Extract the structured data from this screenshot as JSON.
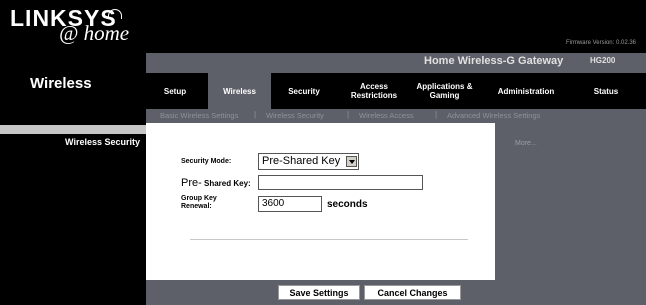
{
  "brand": {
    "name": "LINKSYS",
    "tagline": "@ home"
  },
  "firmware": "Firmware Version: 0.02.36",
  "section": {
    "title": "Wireless",
    "sub_section": "Wireless Security"
  },
  "product": {
    "name": "Home Wireless-G Gateway",
    "model": "HG200"
  },
  "tabs": [
    {
      "label": "Setup",
      "active": false
    },
    {
      "label": "Wireless",
      "active": true
    },
    {
      "label": "Security",
      "active": false
    },
    {
      "label": "Access Restrictions",
      "active": false
    },
    {
      "label": "Applications & Gaming",
      "active": false
    },
    {
      "label": "Administration",
      "active": false
    },
    {
      "label": "Status",
      "active": false
    }
  ],
  "subtabs": [
    "Basic Wireless Settings",
    "Wireless Security",
    "Wireless Access",
    "Advanced Wireless Settings"
  ],
  "form": {
    "security_mode_label": "Security Mode:",
    "security_mode_value": "Pre-Shared Key",
    "psk_label_prefix": "Pre-",
    "psk_label_rest": " Shared Key:",
    "psk_value": "",
    "group_key_label_1": "Group Key",
    "group_key_label_2": "Renewal:",
    "renewal_value": "3600",
    "seconds_label": "seconds"
  },
  "more_link": "More...",
  "buttons": {
    "save": "Save Settings",
    "cancel": "Cancel Changes"
  }
}
